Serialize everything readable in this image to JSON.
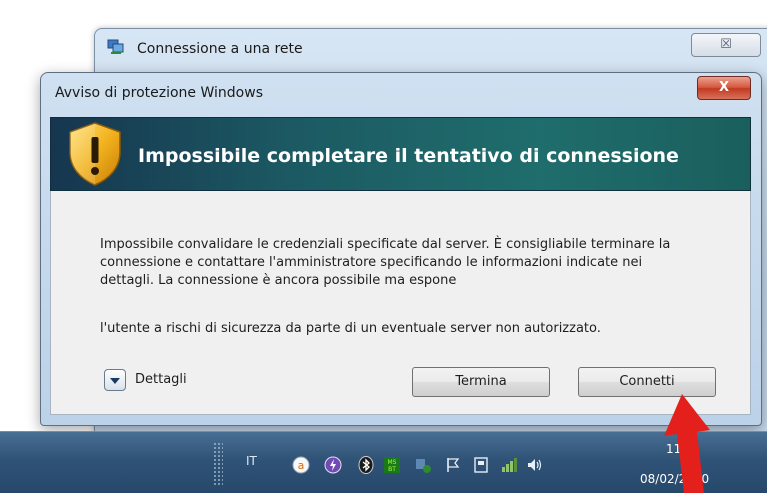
{
  "background_window": {
    "title": "Connessione a una rete",
    "close_symbol": "☒"
  },
  "dialog": {
    "title": "Avviso di protezione Windows",
    "close_symbol": "X",
    "banner_icon": "shield-warning-icon",
    "heading": "Impossibile completare il tentativo di connessione",
    "message_lines": [
      "Impossibile convalidare le credenziali specificate dal server. È consigliabile terminare la",
      "connessione e contattare l'amministratore specificando le informazioni indicate nei",
      "dettagli. La connessione è ancora possibile ma espone",
      "l'utente a rischi di sicurezza da parte di un eventuale server non autorizzato."
    ],
    "details_label": "Dettagli",
    "buttons": {
      "terminate": "Termina",
      "connect": "Connetti"
    }
  },
  "taskbar": {
    "language": "IT",
    "tray_icons": [
      "avast-icon",
      "antivirus-icon",
      "bluetooth-icon",
      "messenger-icon",
      "security-shield-icon",
      "action-center-flag-icon",
      "usb-device-icon",
      "network-icon",
      "volume-icon"
    ],
    "clock_time": "11.3",
    "clock_date": "08/02/2010"
  },
  "colors": {
    "banner_dark": "#16364f",
    "banner_teal": "#1f6d6c",
    "close_red": "#c13a20",
    "taskbar": "#2f5377",
    "arrow": "#e3201b"
  }
}
